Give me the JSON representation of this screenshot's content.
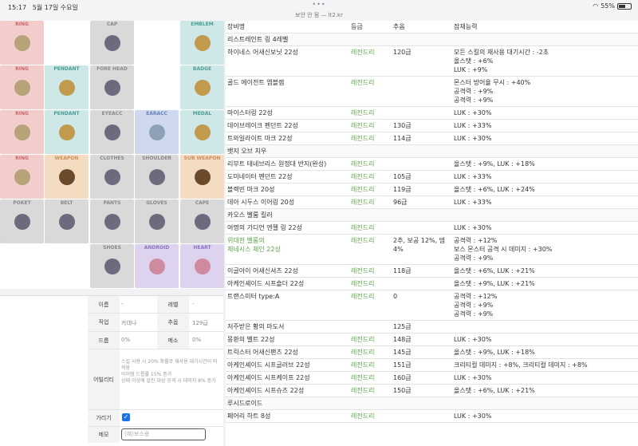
{
  "status": {
    "time": "15:17",
    "date": "5월 17일 수요일",
    "url": "보안 안 됨 — lt2.kr",
    "battery": "55%"
  },
  "slots": [
    {
      "label": "RING",
      "color": "pink"
    },
    {
      "label": "",
      "color": "none"
    },
    {
      "label": "CAP",
      "color": "gray"
    },
    {
      "label": "",
      "color": "none"
    },
    {
      "label": "EMBLEM",
      "color": "teal"
    },
    {
      "label": "RING",
      "color": "pink"
    },
    {
      "label": "PENDANT",
      "color": "teal"
    },
    {
      "label": "FORE HEAD",
      "color": "gray"
    },
    {
      "label": "",
      "color": "none"
    },
    {
      "label": "BADGE",
      "color": "teal"
    },
    {
      "label": "RING",
      "color": "pink"
    },
    {
      "label": "PENDANT",
      "color": "teal"
    },
    {
      "label": "EYEACC",
      "color": "gray"
    },
    {
      "label": "EARACC",
      "color": "blue"
    },
    {
      "label": "MEDAL",
      "color": "teal"
    },
    {
      "label": "RING",
      "color": "pink"
    },
    {
      "label": "WEAPON",
      "color": "orange"
    },
    {
      "label": "CLOTHES",
      "color": "gray"
    },
    {
      "label": "SHOULDER",
      "color": "gray"
    },
    {
      "label": "SUB WEAPON",
      "color": "orange"
    },
    {
      "label": "POKET",
      "color": "gray"
    },
    {
      "label": "BELT",
      "color": "gray"
    },
    {
      "label": "PANTS",
      "color": "gray"
    },
    {
      "label": "GLOVES",
      "color": "gray"
    },
    {
      "label": "CAPE",
      "color": "gray"
    },
    {
      "label": "",
      "color": "none"
    },
    {
      "label": "",
      "color": "none"
    },
    {
      "label": "SHOES",
      "color": "gray"
    },
    {
      "label": "ANDROID",
      "color": "purple"
    },
    {
      "label": "HEART",
      "color": "purple"
    }
  ],
  "info": {
    "name_label": "이름",
    "name_value": "-",
    "level_label": "레벨",
    "level_value": "-",
    "job_label": "직업",
    "job_value": "카데나",
    "stars_label": "추옵",
    "stars_value": "129급",
    "drop_label": "드롭",
    "drop_value": "0%",
    "meso_label": "메소",
    "meso_value": "0%",
    "ability_label": "어빌리티",
    "ability_value": "스킬 사용 시 20% 확률로 재사용 대기시간이 미적용\n아이템 드롭률 15% 증가\n상태 이상에 걸린 대상 공격 시 데미지 8% 증가",
    "hide_label": "가리기",
    "memo_label": "메모",
    "memo_placeholder": "(예)보스용"
  },
  "table": {
    "headers": [
      "장비명",
      "등급",
      "추옵",
      "잠재능력"
    ],
    "rows": [
      {
        "type": "set",
        "name": "리스트레인트 링 4레벨"
      },
      {
        "name": "하이네스 어새신보닛 22성",
        "grade": "레전드리",
        "flame": "120급",
        "potential": "모든 스킬의 재사용 대기시간 : -2초\n올스탯 : +6%\nLUK : +9%"
      },
      {
        "name": "골드 에이전트 엠블렘",
        "grade": "레전드리",
        "flame": "",
        "potential": "몬스터 방어율 무시 : +40%\n공격력 : +9%\n공격력 : +9%"
      },
      {
        "name": "마이스터링 22성",
        "grade": "레전드리",
        "flame": "",
        "potential": "LUK : +30%"
      },
      {
        "name": "데이브레이크 펜던트 22성",
        "grade": "레전드리",
        "flame": "130급",
        "potential": "LUK : +33%"
      },
      {
        "name": "트와일라이트 마크 22성",
        "grade": "레전드리",
        "flame": "114급",
        "potential": "LUK : +30%"
      },
      {
        "type": "set",
        "name": "뱃지 오브 치우"
      },
      {
        "name": "리부트 테네브리스 원정대 반지(완성)",
        "grade": "레전드리",
        "flame": "",
        "potential": "올스탯 : +9%, LUK : +18%"
      },
      {
        "name": "도미네이터 펜던트 22성",
        "grade": "레전드리",
        "flame": "105급",
        "potential": "LUK : +33%"
      },
      {
        "name": "블랙빈 마크 20성",
        "grade": "레전드리",
        "flame": "119급",
        "potential": "올스탯 : +6%, LUK : +24%"
      },
      {
        "name": "데아 시두스 이어링 20성",
        "grade": "레전드리",
        "flame": "96급",
        "potential": "LUK : +33%"
      },
      {
        "type": "set",
        "name": "카오스 벨룸 킬러"
      },
      {
        "name": "여명의 가디언 엔젤 링 22성",
        "grade": "레전드리",
        "flame": "",
        "potential": "LUK : +30%"
      },
      {
        "name": "위대한 벨룸의\n제네시스 체인 22성",
        "grade": "레전드리",
        "flame": "2추, 보공 12%, 뎀 4%",
        "potential": "공격력 : +12%\n보스 몬스터 공격 시 데미지 : +30%\n공격력 : +9%",
        "green_name": true
      },
      {
        "name": "이글아이 어새신셔츠 22성",
        "grade": "레전드리",
        "flame": "118급",
        "potential": "올스탯 : +6%, LUK : +21%"
      },
      {
        "name": "아케인셰이드 시프숄더 22성",
        "grade": "레전드리",
        "flame": "",
        "potential": "올스탯 : +9%, LUK : +21%"
      },
      {
        "name": "트랜스미터 type:A",
        "grade": "레전드리",
        "flame": "0",
        "potential": "공격력 : +12%\n공격력 : +9%\n공격력 : +9%"
      },
      {
        "name": "저주받은 황의 마도서",
        "grade": "",
        "flame": "125급",
        "potential": ""
      },
      {
        "name": "몽환의 벨트 22성",
        "grade": "레전드리",
        "flame": "148급",
        "potential": "LUK : +30%"
      },
      {
        "name": "트릭스터 어새신팬츠 22성",
        "grade": "레전드리",
        "flame": "145급",
        "potential": "올스탯 : +9%, LUK : +18%"
      },
      {
        "name": "아케인셰이드 시프글러브 22성",
        "grade": "레전드리",
        "flame": "151급",
        "potential": "크리티컬 데미지 : +8%, 크리티컬 데미지 : +8%"
      },
      {
        "name": "아케인셰이드 시프케이프 22성",
        "grade": "레전드리",
        "flame": "160급",
        "potential": "LUK : +30%"
      },
      {
        "name": "아케인셰이드 시프슈즈 22성",
        "grade": "레전드리",
        "flame": "150급",
        "potential": "올스탯 : +6%, LUK : +21%"
      },
      {
        "type": "set",
        "name": "루시드로이드"
      },
      {
        "name": "페어리 하트 8성",
        "grade": "레전드리",
        "flame": "",
        "potential": "LUK : +30%"
      }
    ]
  }
}
